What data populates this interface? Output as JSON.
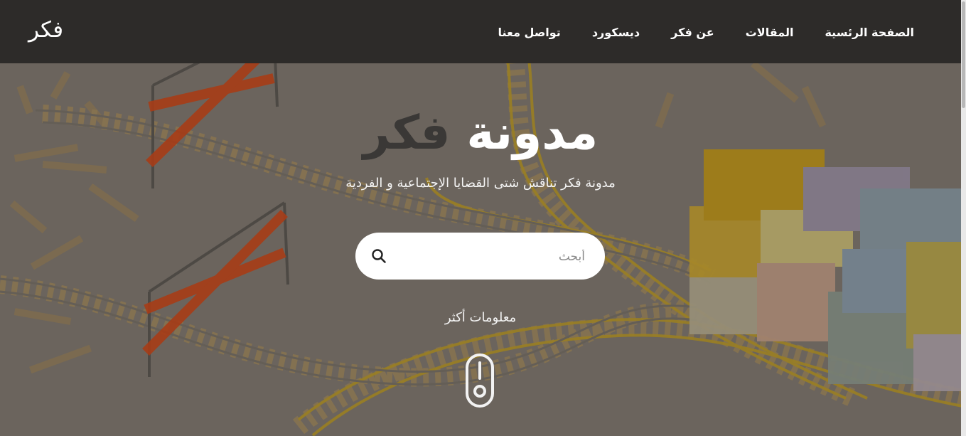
{
  "navbar": {
    "brand": "فكر",
    "links": [
      {
        "label": "الصفحة الرئسية"
      },
      {
        "label": "المقالات"
      },
      {
        "label": "عن فكر"
      },
      {
        "label": "ديسكورد"
      },
      {
        "label": "تواصل معنا"
      }
    ]
  },
  "hero": {
    "title_word_1": "مدونة",
    "title_word_2": "فكر",
    "subtitle": "مدونة فكر تناقش شتى القضايا الإجتماعية و الفردية",
    "search": {
      "placeholder": "أبحث",
      "value": ""
    },
    "more_label": "معلومات أكثر"
  },
  "icons": {
    "search": "search-icon",
    "scroll": "scroll-mouse-icon"
  }
}
